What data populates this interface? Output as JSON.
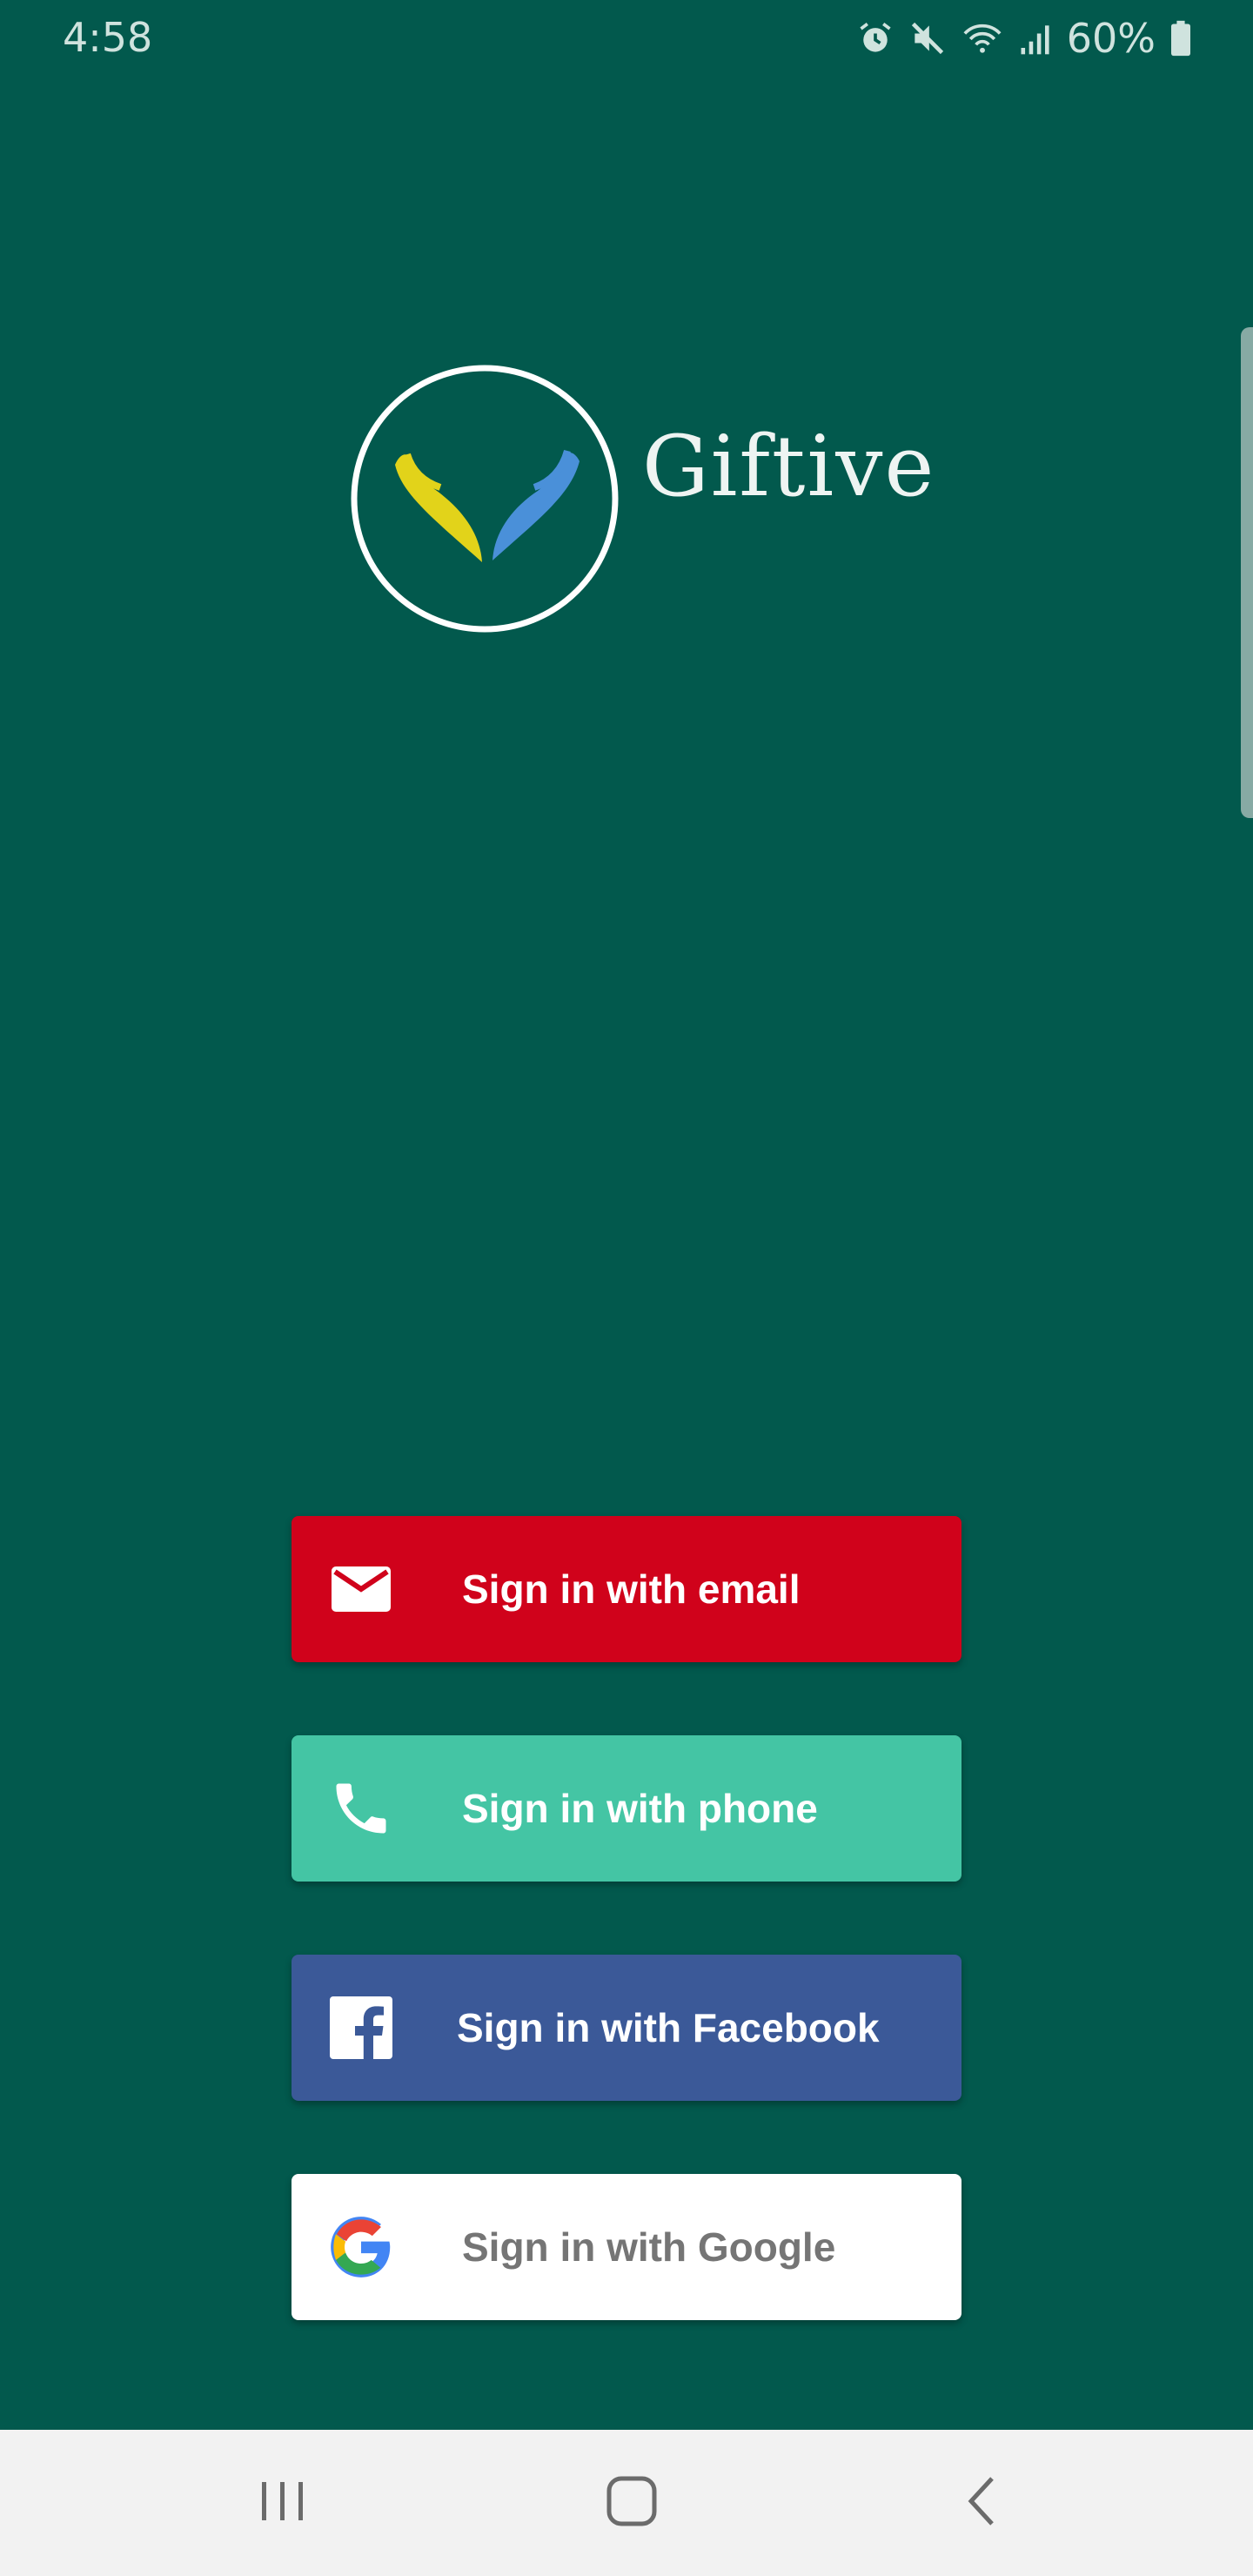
{
  "status_bar": {
    "time": "4:58",
    "battery": "60%",
    "icons": [
      "alarm-icon",
      "mute-icon",
      "wifi-icon",
      "signal-icon",
      "battery-icon"
    ]
  },
  "app": {
    "name": "Giftive",
    "background_color": "#02594d"
  },
  "buttons": {
    "email": {
      "label": "Sign in with email",
      "icon": "mail-icon",
      "color": "#d0021b"
    },
    "phone": {
      "label": "Sign in with phone",
      "icon": "phone-icon",
      "color": "#44c5a4"
    },
    "facebook": {
      "label": "Sign in with Facebook",
      "icon": "facebook-icon",
      "color": "#3b5998"
    },
    "google": {
      "label": "Sign in with Google",
      "icon": "google-icon",
      "color": "#ffffff"
    }
  },
  "nav_bar": {
    "icons": [
      "recent-apps-icon",
      "home-icon",
      "back-icon"
    ]
  }
}
